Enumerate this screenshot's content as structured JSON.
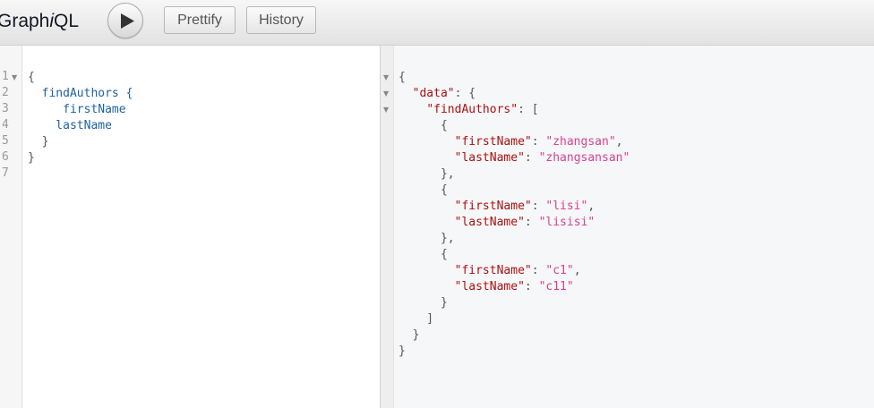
{
  "app": {
    "logo_prefix": "Graph",
    "logo_italic": "i",
    "logo_suffix": "QL"
  },
  "toolbar": {
    "prettify_label": "Prettify",
    "history_label": "History"
  },
  "query_editor": {
    "line_numbers": [
      "1",
      "2",
      "3",
      "4",
      "5",
      "6",
      "7"
    ],
    "lines": [
      "{",
      "  findAuthors {",
      "     firstName",
      "    lastName",
      "  }",
      "}",
      ""
    ],
    "fold_marker": "▼"
  },
  "result_viewer": {
    "lines": [
      "{",
      "  \"data\": {",
      "    \"findAuthors\": [",
      "      {",
      "        \"firstName\": \"zhangsan\",",
      "        \"lastName\": \"zhangsansan\"",
      "      },",
      "      {",
      "        \"firstName\": \"lisi\",",
      "        \"lastName\": \"lisisi\"",
      "      },",
      "      {",
      "        \"firstName\": \"c1\",",
      "        \"lastName\": \"c11\"",
      "      }",
      "    ]",
      "  }",
      "}"
    ],
    "fold_marker": "▼"
  },
  "colors": {
    "field": "#1F61A0",
    "json_key": "#A11",
    "json_string": "#D64292"
  }
}
